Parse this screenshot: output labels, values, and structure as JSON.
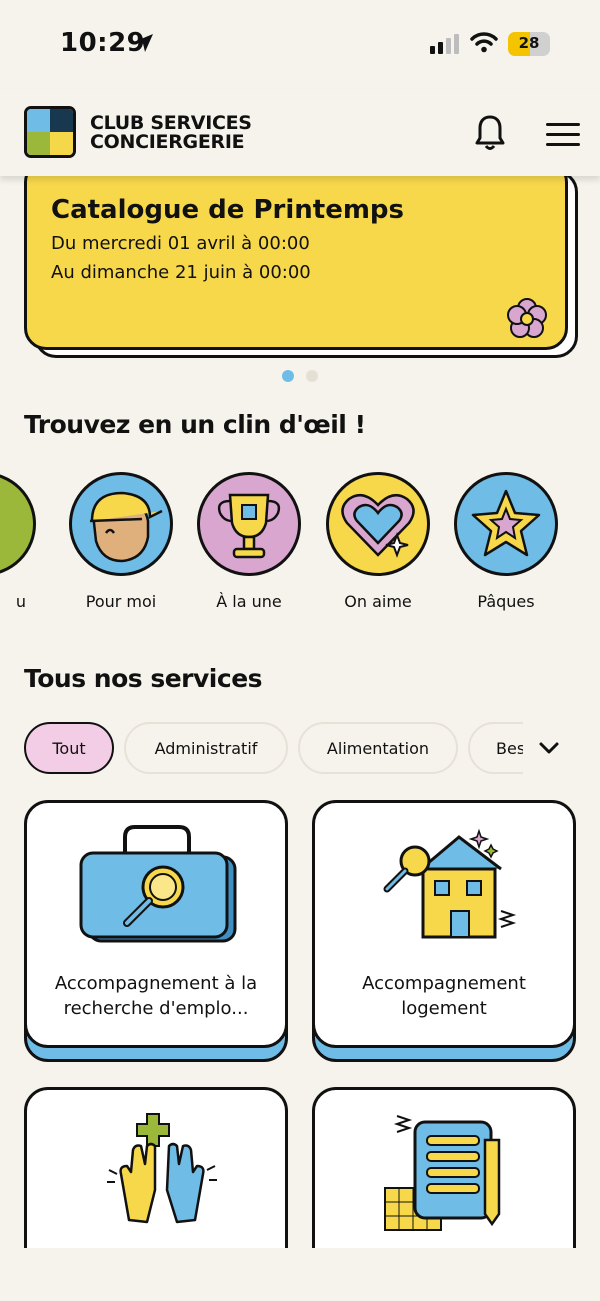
{
  "status": {
    "time": "10:29",
    "battery": "28"
  },
  "header": {
    "brand_line1": "CLUB SERVICES",
    "brand_line2": "CONCIERGERIE",
    "bell_icon": "bell-icon",
    "menu_icon": "hamburger-menu-icon"
  },
  "banner": {
    "title": "Catalogue de Printemps",
    "line1": "Du mercredi 01 avril à 00:00",
    "line2": "Au dimanche 21 juin à 00:00",
    "icon": "flower-icon",
    "active_page": 1,
    "page_count": 2
  },
  "quick": {
    "title": "Trouvez en un clin d'œil !",
    "items": [
      {
        "label": "u",
        "icon": "partial-icon",
        "color": "#9bb83a"
      },
      {
        "label": "Pour moi",
        "icon": "person-cap-icon",
        "color": "#6fbce6"
      },
      {
        "label": "À la une",
        "icon": "trophy-icon",
        "color": "#d9a6cf"
      },
      {
        "label": "On aime",
        "icon": "heart-icon",
        "color": "#f7d84b"
      },
      {
        "label": "Pâques",
        "icon": "star-icon",
        "color": "#6fbce6"
      }
    ]
  },
  "services": {
    "title": "Tous nos services",
    "filters": [
      "Tout",
      "Administratif",
      "Alimentation",
      "Bes"
    ],
    "active_filter": "Tout",
    "cards": [
      {
        "title": "Accompagnement à la recherche d'emplo...",
        "icon": "briefcase-search-icon"
      },
      {
        "title": "Accompagnement logement",
        "icon": "house-search-icon"
      },
      {
        "title": "",
        "icon": "high-five-hands-icon"
      },
      {
        "title": "",
        "icon": "notepad-pencil-icon"
      }
    ]
  }
}
